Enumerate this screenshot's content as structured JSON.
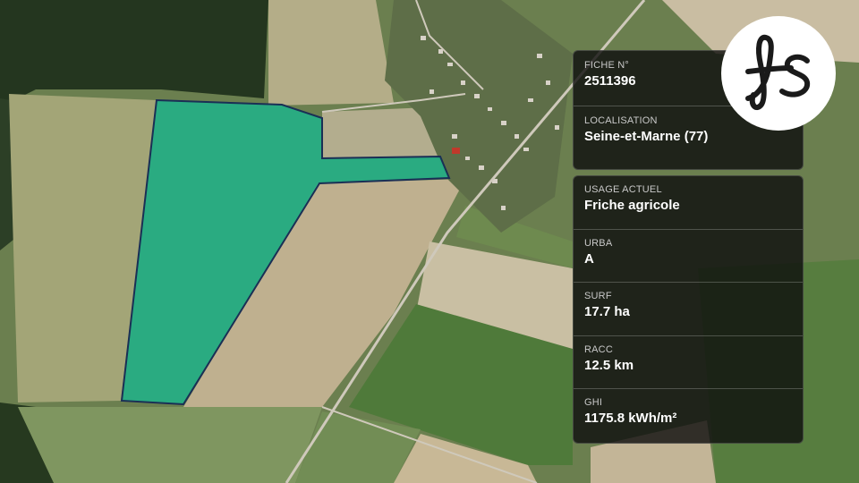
{
  "map": {
    "parcel_color": "#1fb389",
    "parcel_outline": "#1a2f55"
  },
  "card_top": {
    "fiche_label": "FICHE N°",
    "fiche_value": "2511396",
    "localisation_label": "LOCALISATION",
    "localisation_value": "Seine-et-Marne (77)"
  },
  "card_bottom": {
    "usage_label": "USAGE ACTUEL",
    "usage_value": "Friche agricole",
    "urba_label": "URBA",
    "urba_value": "A",
    "surf_label": "SURF",
    "surf_value": "17.7 ha",
    "racc_label": "RACC",
    "racc_value": "12.5 km",
    "ghi_label": "GHI",
    "ghi_value": "1175.8 kWh/m²"
  },
  "logo": {
    "icon": "fs-monogram-logo"
  }
}
